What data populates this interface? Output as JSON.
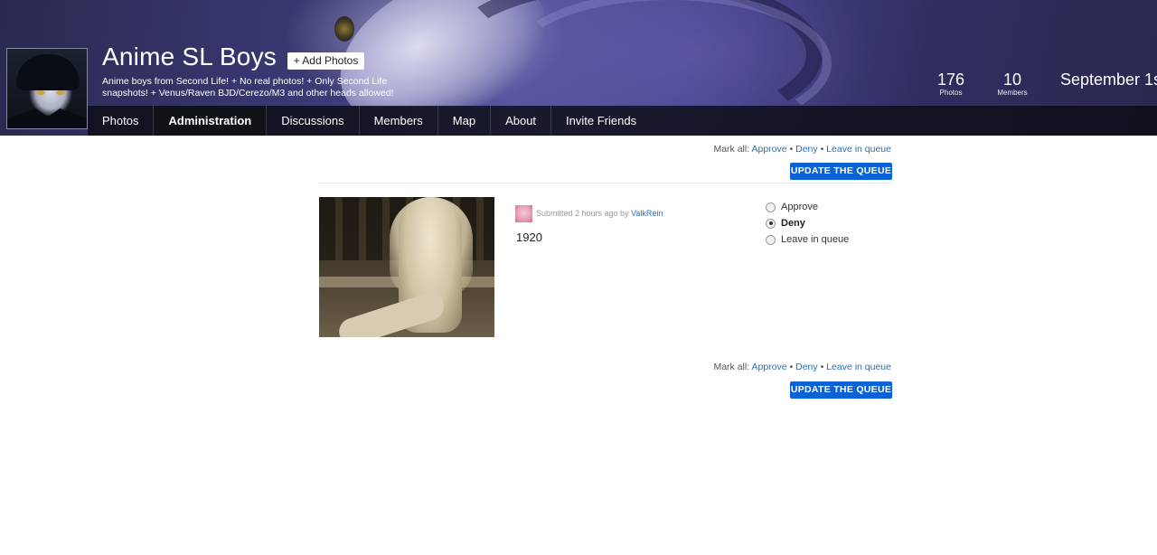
{
  "header": {
    "title": "Anime SL Boys",
    "add_photos_label": "+ Add Photos",
    "description": "Anime boys from Second Life! + No real photos! + Only Second Life snapshots! + Venus/Raven BJD/Cerezo/M3 and other heads allowed!",
    "stats": [
      {
        "value": "176",
        "label": "Photos"
      },
      {
        "value": "10",
        "label": "Members"
      }
    ],
    "date_fragment": "September 1s"
  },
  "nav": {
    "items": [
      {
        "label": "Photos",
        "active": false
      },
      {
        "label": "Administration",
        "active": true
      },
      {
        "label": "Discussions",
        "active": false
      },
      {
        "label": "Members",
        "active": false
      },
      {
        "label": "Map",
        "active": false
      },
      {
        "label": "About",
        "active": false
      },
      {
        "label": "Invite Friends",
        "active": false
      }
    ]
  },
  "queue": {
    "mark_all_label": "Mark all:",
    "approve_label": "Approve",
    "deny_label": "Deny",
    "leave_label": "Leave in queue",
    "separator": "•",
    "update_button_label": "UPDATE THE QUEUE",
    "items": [
      {
        "submitted_prefix": "Submitted 2 hours ago by",
        "submitted_by": "ValkRein",
        "title": "1920",
        "options": [
          "Approve",
          "Deny",
          "Leave in queue"
        ],
        "selected_option": "Deny"
      }
    ]
  },
  "colors": {
    "link": "#2c6fb5",
    "button": "#0b62d6",
    "banner": "#3d3b78"
  },
  "icons": {
    "group_avatar": "group-avatar-image",
    "submitter_avatar": "user-avatar-image"
  }
}
